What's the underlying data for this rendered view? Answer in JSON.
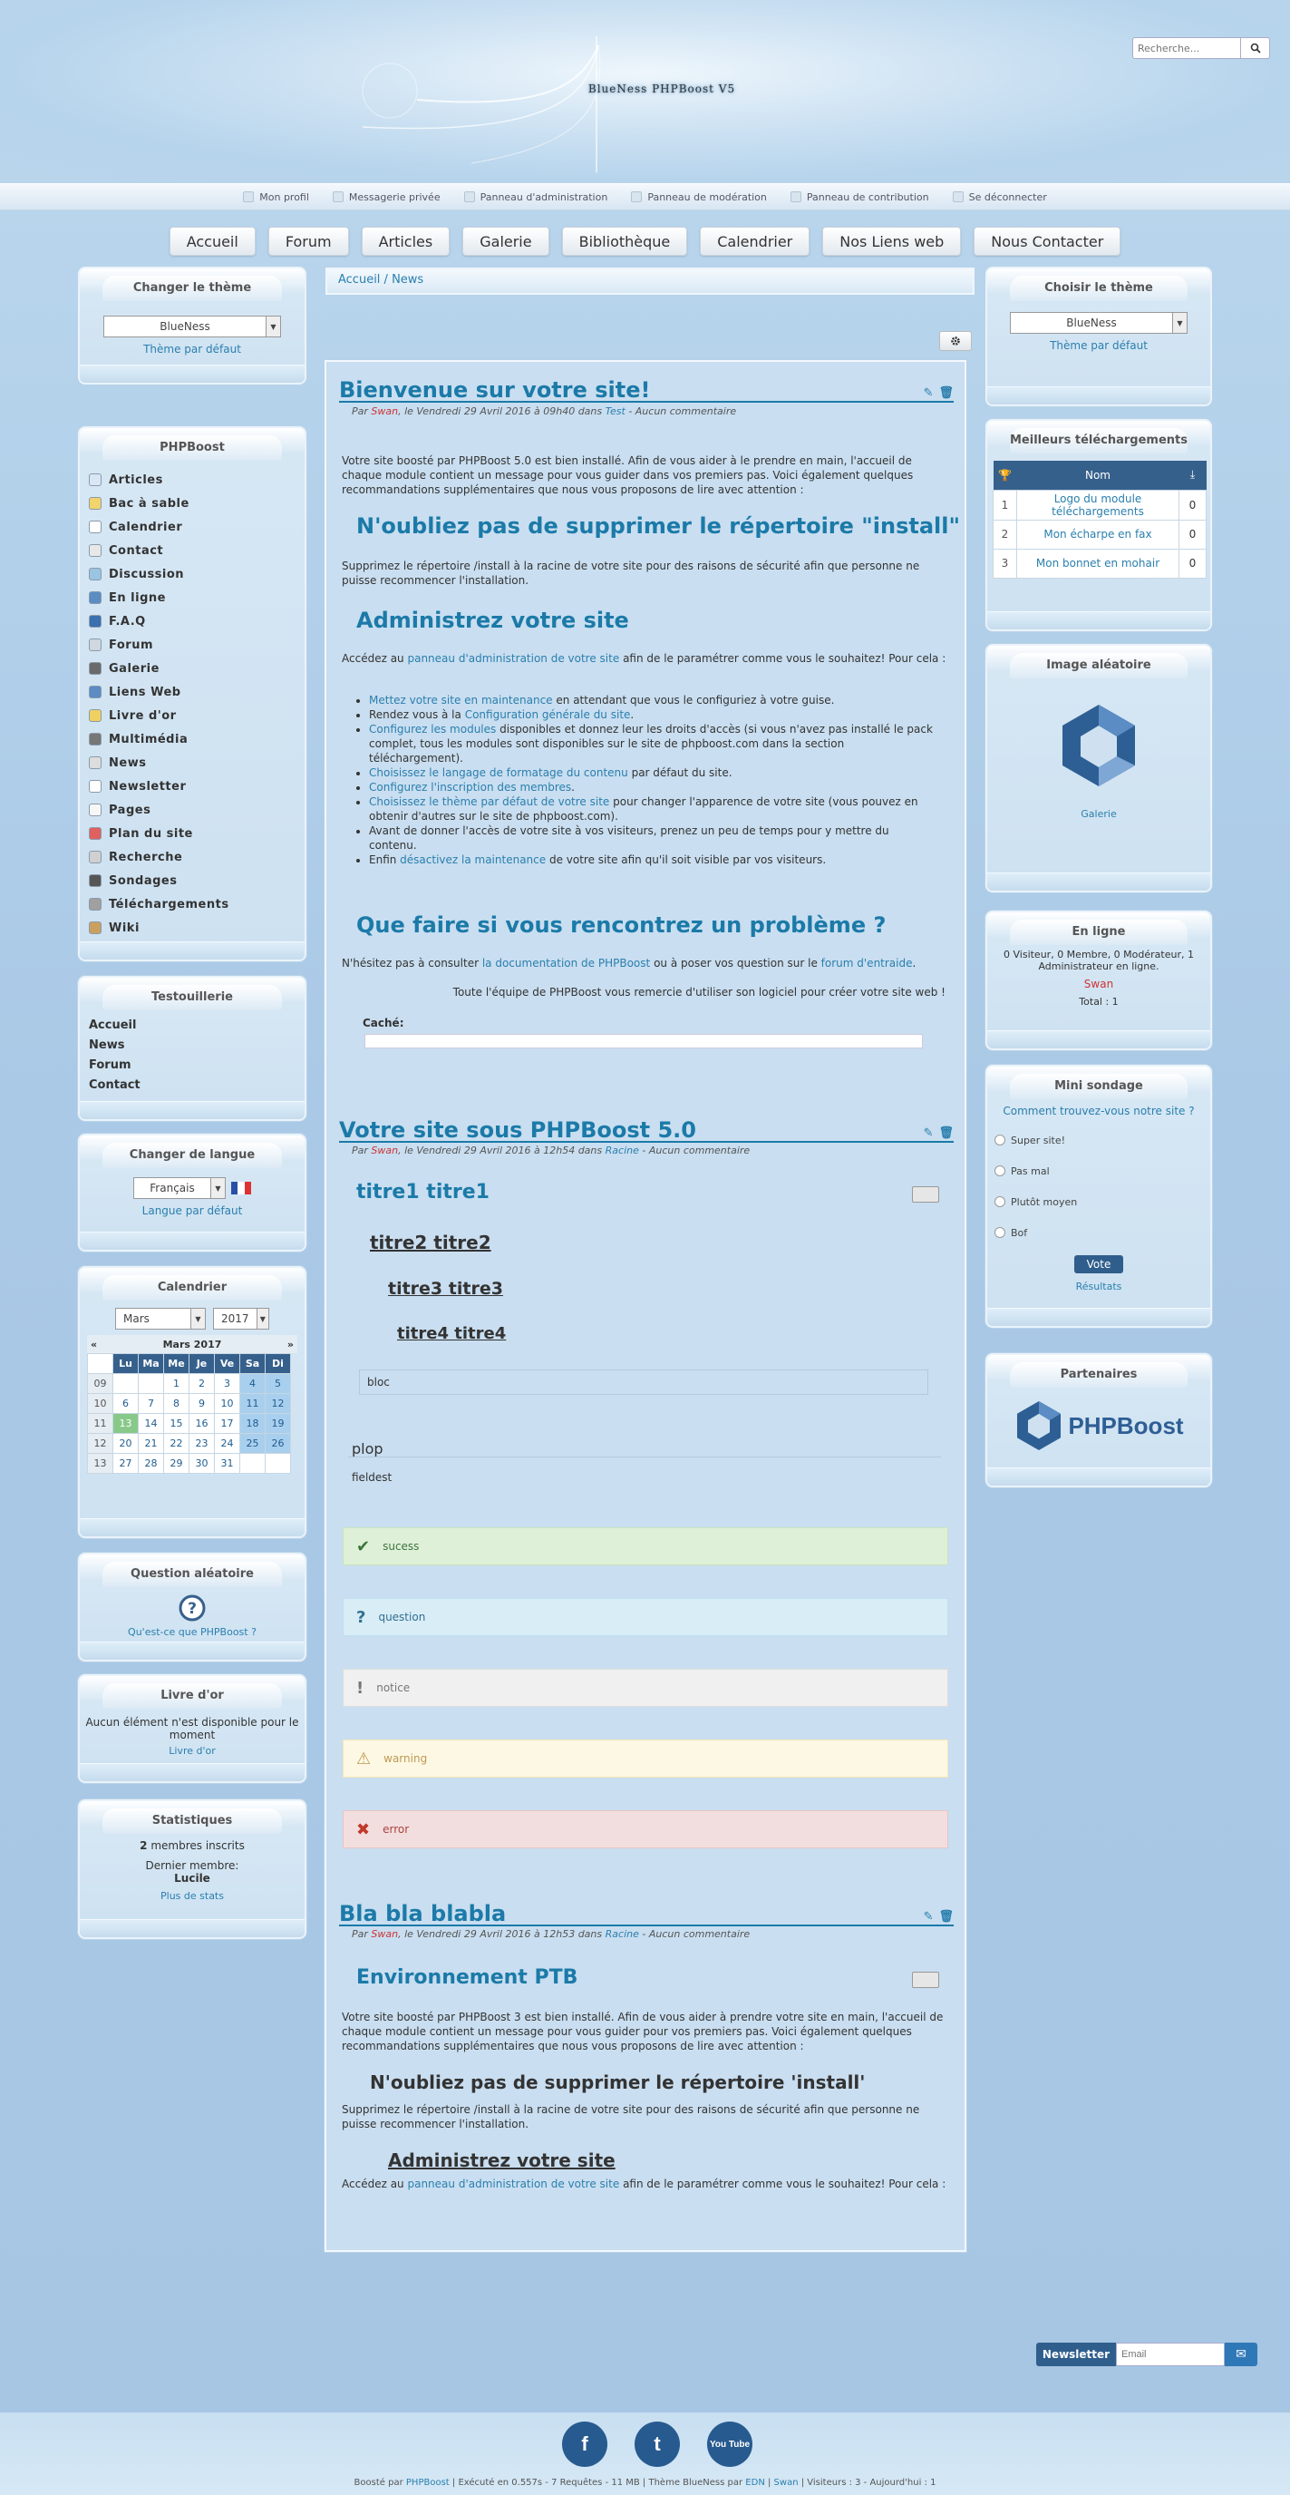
{
  "header": {
    "logo_text": "BlueNess PHPBoost V5",
    "search_placeholder": "Recherche..."
  },
  "userbar": [
    {
      "label": "Mon profil",
      "icon": "user-icon"
    },
    {
      "label": "Messagerie privée",
      "icon": "envelope-icon"
    },
    {
      "label": "Panneau d'administration",
      "icon": "wrench-icon"
    },
    {
      "label": "Panneau de modération",
      "icon": "gavel-icon"
    },
    {
      "label": "Panneau de contribution",
      "icon": "file-icon"
    },
    {
      "label": "Se déconnecter",
      "icon": "power-icon"
    }
  ],
  "menu": [
    "Accueil",
    "Forum",
    "Articles",
    "Galerie",
    "Bibliothèque",
    "Calendrier",
    "Nos Liens web",
    "Nous Contacter"
  ],
  "left": {
    "theme": {
      "title": "Changer le thème",
      "value": "BlueNess",
      "default_link": "Thème par défaut"
    },
    "phpboost": {
      "title": "PHPBoost",
      "items": [
        "Articles",
        "Bac à sable",
        "Calendrier",
        "Contact",
        "Discussion",
        "En ligne",
        "F.A.Q",
        "Forum",
        "Galerie",
        "Liens Web",
        "Livre d'or",
        "Multimédia",
        "News",
        "Newsletter",
        "Pages",
        "Plan du site",
        "Recherche",
        "Sondages",
        "Téléchargements",
        "Wiki"
      ]
    },
    "testouillerie": {
      "title": "Testouillerie",
      "items": [
        "Accueil",
        "News",
        "Forum",
        "Contact"
      ]
    },
    "lang": {
      "title": "Changer de langue",
      "value": "Français",
      "default_link": "Langue par défaut"
    },
    "calendar": {
      "title": "Calendrier",
      "month": "Mars",
      "year": "2017",
      "caption": "Mars 2017",
      "prev": "«",
      "next": "»",
      "headers": [
        "",
        "Lu",
        "Ma",
        "Me",
        "Je",
        "Ve",
        "Sa",
        "Di"
      ],
      "rows": [
        [
          "09",
          "",
          "",
          "1",
          "2",
          "3",
          "4",
          "5"
        ],
        [
          "10",
          "6",
          "7",
          "8",
          "9",
          "10",
          "11",
          "12"
        ],
        [
          "11",
          "13",
          "14",
          "15",
          "16",
          "17",
          "18",
          "19"
        ],
        [
          "12",
          "20",
          "21",
          "22",
          "23",
          "24",
          "25",
          "26"
        ],
        [
          "13",
          "27",
          "28",
          "29",
          "30",
          "31",
          "",
          ""
        ]
      ]
    },
    "question": {
      "title": "Question aléatoire",
      "link": "Qu'est-ce que PHPBoost ?"
    },
    "guestbook": {
      "title": "Livre d'or",
      "text": "Aucun élément n'est disponible pour le moment",
      "link": "Livre d'or"
    },
    "stats": {
      "title": "Statistiques",
      "members_count": "2",
      "members_label": "membres inscrits",
      "last_label": "Dernier membre:",
      "last_member": "Lucile",
      "link": "Plus de stats"
    }
  },
  "breadcrumb": "Accueil / News",
  "articles": {
    "a1": {
      "title": "Bienvenue sur votre site!",
      "meta_prefix": "Par",
      "author": "Swan",
      "meta_date": ", le Vendredi 29 Avril 2016 à 09h40 dans",
      "category": "Test",
      "meta_suffix": "- Aucun commentaire",
      "intro": "Votre site boosté par PHPBoost 5.0 est bien installé. Afin de vous aider à le prendre en main, l'accueil de chaque module contient un message pour vous guider dans vos premiers pas. Voici également quelques recommandations supplémentaires que nous vous proposons de lire avec attention :",
      "h_install": "N'oubliez pas de supprimer le répertoire \"install\"",
      "p_install": "Supprimez le répertoire /install à la racine de votre site pour des raisons de sécurité afin que personne ne puisse recommencer l'installation.",
      "h_admin": "Administrez votre site",
      "p_admin_a": "Accédez au",
      "p_admin_link": "panneau d'administration de votre site",
      "p_admin_b": "afin de le paramétrer comme vous le souhaitez! Pour cela :",
      "bullets": [
        {
          "link": "Mettez votre site en maintenance",
          "text": " en attendant que vous le configuriez à votre guise."
        },
        {
          "pre": "Rendez vous à la ",
          "link": "Configuration générale du site",
          "text": "."
        },
        {
          "link": "Configurez les modules",
          "text": " disponibles et donnez leur les droits d'accès (si vous n'avez pas installé le pack complet, tous les modules sont disponibles sur le site de phpboost.com dans la section téléchargement)."
        },
        {
          "link": "Choisissez le langage de formatage du contenu",
          "text": " par défaut du site."
        },
        {
          "link": "Configurez l'inscription des membres",
          "text": "."
        },
        {
          "link": "Choisissez le thème par défaut de votre site",
          "text": " pour changer l'apparence de votre site (vous pouvez en obtenir d'autres sur le site de phpboost.com)."
        },
        {
          "pre": "Avant de donner l'accès de votre site à vos visiteurs, prenez un peu de temps pour y mettre du contenu.",
          "link": "",
          "text": ""
        },
        {
          "pre": "Enfin ",
          "link": "désactivez la maintenance",
          "text": " de votre site afin qu'il soit visible par vos visiteurs."
        }
      ],
      "h_problem": "Que faire si vous rencontrez un problème ?",
      "p_problem_a": "N'hésitez pas à consulter",
      "p_problem_link1": "la documentation de PHPBoost",
      "p_problem_b": "ou à poser vos question sur le",
      "p_problem_link2": "forum d'entraide",
      "p_problem_c": ".",
      "thanks": "Toute l'équipe de PHPBoost vous remercie d'utiliser son logiciel pour créer votre site web !",
      "hidden_label": "Caché:"
    },
    "a2": {
      "title": "Votre site sous PHPBoost 5.0",
      "meta_prefix": "Par",
      "author": "Swan",
      "meta_date": ", le Vendredi 29 Avril 2016 à 12h54 dans",
      "category": "Racine",
      "meta_suffix": "- Aucun commentaire",
      "t1": "titre1 titre1",
      "t2": "titre2 titre2",
      "t3": "titre3 titre3",
      "t4": "titre4 titre4",
      "bloc": "bloc",
      "fs_legend": "plop",
      "fs_text": "fieldest",
      "alerts": [
        {
          "kind": "success",
          "text": "sucess",
          "icon": "check-icon",
          "bg": "#dff0d8",
          "border": "#c9e3bd",
          "color": "#3c763d"
        },
        {
          "kind": "question",
          "text": "question",
          "icon": "question-icon",
          "bg": "#d9edf7",
          "border": "#bfe0f0",
          "color": "#31708f"
        },
        {
          "kind": "notice",
          "text": "notice",
          "icon": "exclamation-icon",
          "bg": "#f0f0f0",
          "border": "#dcdcdc",
          "color": "#777777"
        },
        {
          "kind": "warning",
          "text": "warning",
          "icon": "warning-icon",
          "bg": "#fcf8e3",
          "border": "#f3e6b3",
          "color": "#c09853"
        },
        {
          "kind": "error",
          "text": "error",
          "icon": "close-icon",
          "bg": "#f2dede",
          "border": "#e8c4c4",
          "color": "#a94442"
        }
      ]
    },
    "a3": {
      "title": "Bla bla blabla",
      "meta_prefix": "Par",
      "author": "Swan",
      "meta_date": ", le Vendredi 29 Avril 2016 à 12h53 dans",
      "category": "Racine",
      "meta_suffix": "- Aucun commentaire",
      "h_env": "Environnement PTB",
      "p_env": "Votre site boosté par PHPBoost 3 est bien installé. Afin de vous aider à prendre votre site en main, l'accueil de chaque module contient un message pour vous guider pour vos premiers pas. Voici également quelques recommandations supplémentaires que nous vous proposons de lire avec attention :",
      "h_install": "N'oubliez pas de supprimer le répertoire 'install'",
      "p_install": "Supprimez le répertoire /install à la racine de votre site pour des raisons de sécurité afin que personne ne puisse recommencer l'installation.",
      "h_admin": "Administrez votre site",
      "p_admin_a": "Accédez au",
      "p_admin_link": "panneau d'administration de votre site",
      "p_admin_b": "afin de le paramétrer comme vous le souhaitez! Pour cela :"
    }
  },
  "right": {
    "theme": {
      "title": "Choisir le thème",
      "value": "BlueNess",
      "default_link": "Thème par défaut"
    },
    "downloads": {
      "title": "Meilleurs téléchargements",
      "col_name": "Nom",
      "rows": [
        {
          "rank": "1",
          "name": "Logo du module téléchargements",
          "count": "0"
        },
        {
          "rank": "2",
          "name": "Mon écharpe en fax",
          "count": "0"
        },
        {
          "rank": "3",
          "name": "Mon bonnet en mohair",
          "count": "0"
        }
      ]
    },
    "image": {
      "title": "Image aléatoire",
      "link": "Galerie"
    },
    "online": {
      "title": "En ligne",
      "text": "0 Visiteur, 0 Membre, 0 Modérateur, 1 Administrateur en ligne.",
      "user": "Swan",
      "total": "Total : 1"
    },
    "poll": {
      "title": "Mini sondage",
      "question": "Comment trouvez-vous notre site ?",
      "options": [
        "Super site!",
        "Pas mal",
        "Plutôt moyen",
        "Bof"
      ],
      "vote": "Vote",
      "results": "Résultats"
    },
    "partners": {
      "title": "Partenaires",
      "logo_text": "PHPBoost"
    }
  },
  "newsletter": {
    "label": "Newsletter",
    "placeholder": "Email"
  },
  "footer": {
    "social": [
      "f",
      "t",
      "You Tube"
    ],
    "p1": "Boosté par",
    "l1": "PHPBoost",
    "p2": "| Exécuté en 0.557s - 7 Requêtes - 11 MB | Thème BlueNess par",
    "l2": "EDN",
    "p3": "|",
    "l3": "Swan",
    "p4": "| Visiteurs : 3 - Aujourd'hui : 1"
  }
}
